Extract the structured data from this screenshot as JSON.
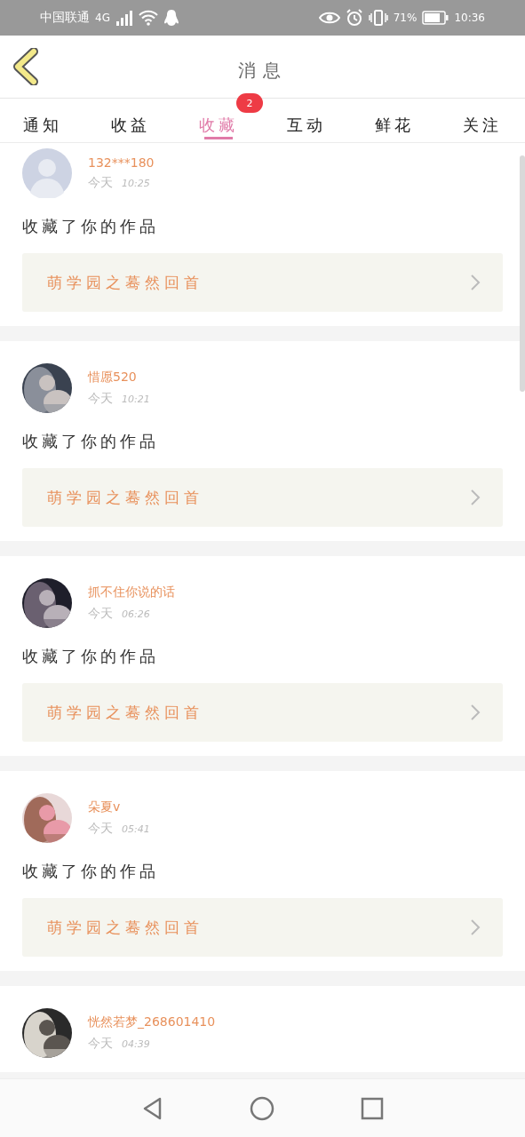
{
  "status_bar": {
    "carrier": "中国联通",
    "network": "4G",
    "battery": "71%",
    "time": "10:36"
  },
  "header": {
    "title": "消息"
  },
  "tabs": [
    {
      "label": "通知",
      "selected": false
    },
    {
      "label": "收益",
      "selected": false
    },
    {
      "label": "收藏",
      "selected": true,
      "badge": "2"
    },
    {
      "label": "互动",
      "selected": false
    },
    {
      "label": "鲜花",
      "selected": false
    },
    {
      "label": "关注",
      "selected": false
    }
  ],
  "messages": [
    {
      "kind": "default",
      "name": "132***180",
      "date": "今天",
      "time": "10:25",
      "text": "收藏了你的作品",
      "work": "萌学园之蓦然回首"
    },
    {
      "kind": "picture",
      "name": "惜愿520",
      "date": "今天",
      "time": "10:21",
      "text": "收藏了你的作品",
      "work": "萌学园之蓦然回首"
    },
    {
      "kind": "picture",
      "name": "抓不住你说的话",
      "date": "今天",
      "time": "06:26",
      "text": "收藏了你的作品",
      "work": "萌学园之蓦然回首"
    },
    {
      "kind": "picture",
      "name": "朵夏v",
      "date": "今天",
      "time": "05:41",
      "text": "收藏了你的作品",
      "work": "萌学园之蓦然回首"
    },
    {
      "kind": "picture",
      "name": "恍然若梦_268601410",
      "date": "今天",
      "time": "04:39"
    }
  ]
}
